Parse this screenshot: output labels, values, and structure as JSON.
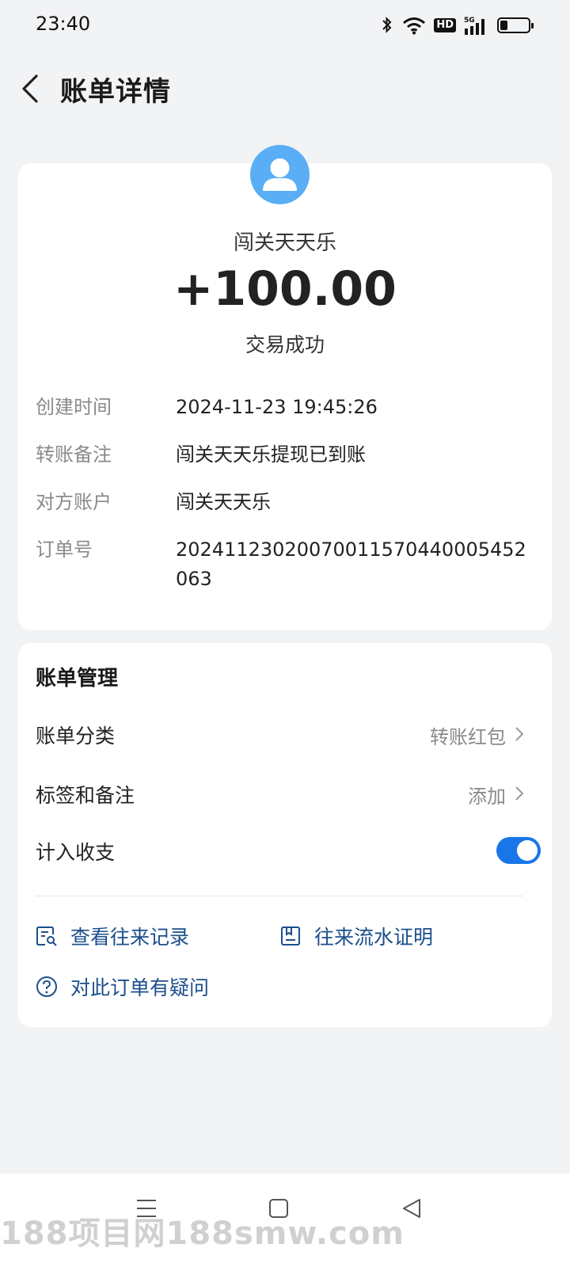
{
  "status_bar": {
    "time": "23:40",
    "hd_label": "HD",
    "network": "5G",
    "battery_level": 0.25
  },
  "header": {
    "title": "账单详情"
  },
  "transaction": {
    "payer": "闯关天天乐",
    "amount": "+100.00",
    "status": "交易成功",
    "details": [
      {
        "label": "创建时间",
        "value": "2024-11-23 19:45:26"
      },
      {
        "label": "转账备注",
        "value": "闯关天天乐提现已到账"
      },
      {
        "label": "对方账户",
        "value": "闯关天天乐"
      },
      {
        "label": "订单号",
        "value": "20241123020070011570440005452063"
      }
    ]
  },
  "manage": {
    "title": "账单管理",
    "category_label": "账单分类",
    "category_value": "转账红包",
    "tags_label": "标签和备注",
    "tags_value": "添加",
    "count_label": "计入收支",
    "count_enabled": true,
    "links": {
      "records": "查看往来记录",
      "statement": "往来流水证明",
      "question": "对此订单有疑问"
    }
  },
  "colors": {
    "accent": "#1976e8",
    "link": "#1c4f8c",
    "avatar": "#5aaef5"
  },
  "watermark": "188项目网188smw.com"
}
